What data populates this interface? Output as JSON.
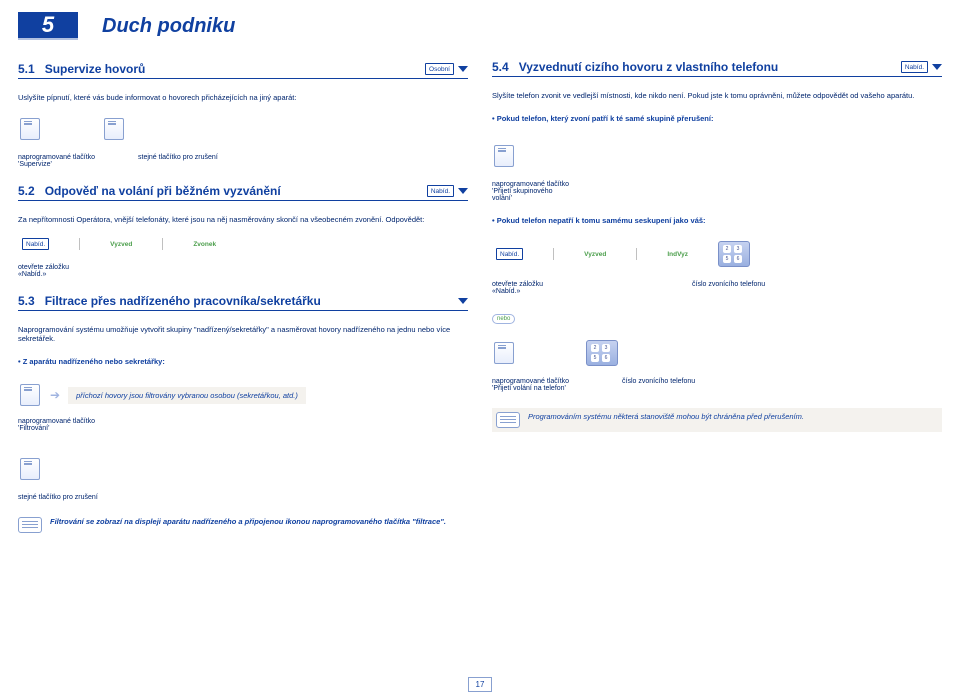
{
  "chapter": {
    "number": "5",
    "title": "Duch podniku"
  },
  "left": {
    "s51": {
      "num": "5.1",
      "title": "Supervize hovorů",
      "tag": "Osobní"
    },
    "s51_desc": "Uslyšíte pípnutí, které vás bude informovat o hovorech přicházejících na jiný aparát:",
    "k1_cap": "naprogramované tlačítko 'Supervize'",
    "k2_cap": "stejné tlačítko pro zrušení",
    "s52": {
      "num": "5.2",
      "title": "Odpověď na volání při běžném vyzvánění",
      "tag": "Nabíd."
    },
    "s52_desc": "Za nepřítomnosti Operátora, vnější telefonáty, které jsou na něj nasměrovány skončí na všeobecném zvonění. Odpovědět:",
    "tags52": {
      "a": "Nabíd.",
      "b": "Vyzved"
    },
    "s52_green": "Zvonek",
    "s52_cap": "otevřete záložku «Nabíd.»",
    "s53": {
      "num": "5.3",
      "title": "Filtrace přes nadřízeného pracovníka/sekretářku"
    },
    "s53_desc": "Naprogramování systému umožňuje vytvořit skupiny \"nadřízený/sekretářky\" a nasměrovat hovory nadřízeného na jednu nebo více sekretářek.",
    "s53_bullet": "Z aparátu nadřízeného nebo sekretářky:",
    "s53_box": "příchozí hovory jsou filtrovány vybranou osobou (sekretářkou, atd.)",
    "s53_k_cap": "naprogramované tlačítko 'Filtrování'",
    "s53_k2_cap": "stejné tlačítko pro zrušení",
    "s53_note": "Filtrování se zobrazí na displeji aparátu nadřízeného a připojenou ikonou naprogramovaného tlačítka \"filtrace\"."
  },
  "right": {
    "s54": {
      "num": "5.4",
      "title": "Vyzvednutí cizího hovoru z vlastního telefonu",
      "tag": "Nabíd."
    },
    "s54_desc": "Slyšíte telefon zvonit ve vedlejší místnosti, kde nikdo není. Pokud jste k tomu oprávněni, můžete odpovědět od vašeho aparátu.",
    "s54_bullet": "Pokud telefon, který zvoní patří k té samé skupině přerušení:",
    "s54_k_cap": "naprogramované tlačítko 'Přijetí skupinového volání'",
    "s54_bullet2": "Pokud telefon nepatří k tomu samému seskupení jako váš:",
    "tags54": {
      "a": "Nabíd.",
      "b": "Vyzved"
    },
    "s54_green": "IndVyz",
    "s54_cap1": "otevřete záložku «Nabíd.»",
    "s54_cap2": "číslo zvonícího telefonu",
    "s54_k2_cap": "naprogramované tlačítko 'Přijetí volání na telefon'",
    "s54_cap3": "číslo zvonícího telefonu",
    "s54_note": "Programováním systému některá stanoviště mohou být chráněna před přerušením.",
    "nebo": "nebo"
  },
  "pagenum": "17"
}
